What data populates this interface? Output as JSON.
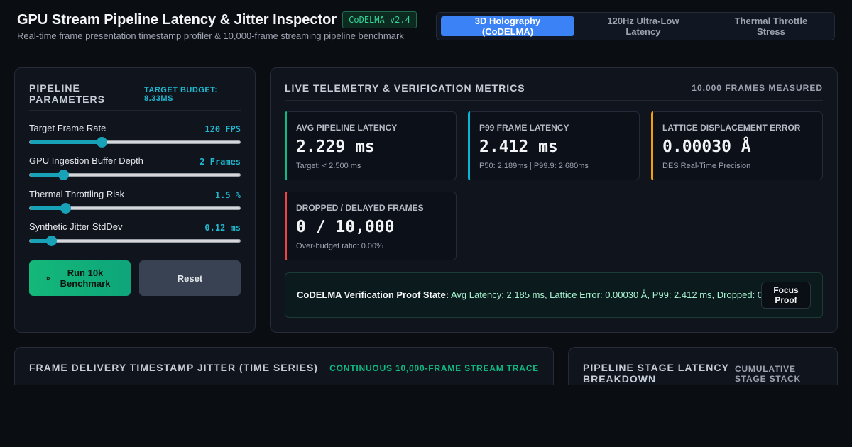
{
  "header": {
    "title": "GPU Stream Pipeline Latency & Jitter Inspector",
    "version_badge": "CoDELMA v2.4",
    "subtitle": "Real-time frame presentation timestamp profiler & 10,000-frame streaming pipeline benchmark"
  },
  "tabs": [
    {
      "label": "3D Holography (CoDELMA)",
      "active": true
    },
    {
      "label": "120Hz Ultra-Low Latency",
      "active": false
    },
    {
      "label": "Thermal Throttle Stress",
      "active": false
    }
  ],
  "params": {
    "title": "Pipeline Parameters",
    "budget": "Target Budget: 8.33ms",
    "items": [
      {
        "label": "Target Frame Rate",
        "value": "120 FPS",
        "level": 0.34
      },
      {
        "label": "GPU Ingestion Buffer Depth",
        "value": "2 Frames",
        "level": 0.16
      },
      {
        "label": "Thermal Throttling Risk",
        "value": "1.5 %",
        "level": 0.17
      },
      {
        "label": "Synthetic Jitter StdDev",
        "value": "0.12 ms",
        "level": 0.1
      }
    ],
    "run_icon": "▹",
    "run_label": "Run 10k Benchmark",
    "reset_label": "Reset"
  },
  "telemetry": {
    "title": "Live Telemetry & Verification Metrics",
    "frames_measured": "10,000 Frames Measured",
    "cards": [
      {
        "label": "Avg Pipeline Latency",
        "value": "2.229 ms",
        "sub": "Target: < 2.500 ms",
        "accent": "#10b981"
      },
      {
        "label": "P99 Frame Latency",
        "value": "2.412 ms",
        "sub": "P50: 2.189ms | P99.9: 2.680ms",
        "accent": "#06b6d4"
      },
      {
        "label": "Lattice Displacement Error",
        "value": "0.00030 Å",
        "sub": "DES Real-Time Precision",
        "accent": "#f59e0b"
      },
      {
        "label": "Dropped / Delayed Frames",
        "value": "0 / 10,000",
        "sub": "Over-budget ratio: 0.00%",
        "accent": "#ef4444"
      }
    ],
    "proof": {
      "label": "CoDELMA Verification Proof State:",
      "text": "Avg Latency: 2.185 ms, Lattice Error: 0.00030 Å, P99: 2.412 ms, Dropped: 0",
      "button": "Focus Proof"
    }
  },
  "jitter": {
    "title": "Frame Delivery Timestamp Jitter (Time Series)",
    "trace_label": "Continuous 10,000-Frame Stream Trace"
  },
  "stages": {
    "title": "Pipeline Stage Latency Breakdown",
    "stack_label": "Cumulative Stage Stack"
  }
}
